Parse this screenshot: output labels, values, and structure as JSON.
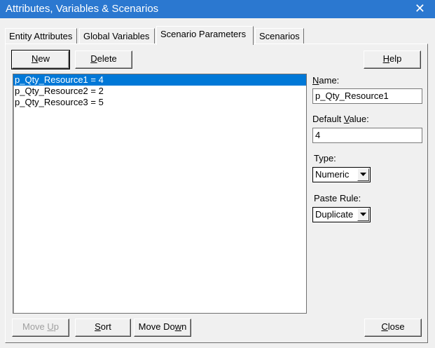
{
  "window": {
    "title": "Attributes, Variables & Scenarios"
  },
  "tabs": [
    {
      "label": "Entity Attributes"
    },
    {
      "label": "Global Variables"
    },
    {
      "label": "Scenario Parameters",
      "active": true
    },
    {
      "label": "Scenarios"
    }
  ],
  "toolbar": {
    "new_label": {
      "pre": "",
      "key": "N",
      "post": "ew"
    },
    "delete_label": {
      "pre": "",
      "key": "D",
      "post": "elete"
    },
    "help_label": {
      "pre": "",
      "key": "H",
      "post": "elp"
    }
  },
  "parameters": {
    "items": [
      "p_Qty_Resource1 = 4",
      "p_Qty_Resource2 = 2",
      "p_Qty_Resource3 = 5"
    ],
    "selected_index": 0
  },
  "details": {
    "name_label": {
      "pre": "",
      "key": "N",
      "post": "ame:"
    },
    "name_value": "p_Qty_Resource1",
    "default_label": {
      "pre": "Default ",
      "key": "V",
      "post": "alue:"
    },
    "default_value": "4",
    "type_label": "Type:",
    "type_value": "Numeric",
    "paste_label": "Paste Rule:",
    "paste_value": "Duplicate"
  },
  "footer": {
    "move_up_label": {
      "pre": "Move ",
      "key": "U",
      "post": "p"
    },
    "sort_label": {
      "pre": "",
      "key": "S",
      "post": "ort"
    },
    "move_down_label": {
      "pre": "Move Do",
      "key": "w",
      "post": "n"
    },
    "close_label": {
      "pre": "",
      "key": "C",
      "post": "lose"
    }
  },
  "colors": {
    "titlebar": "#2b78d0",
    "selection": "#0078d7",
    "disabled_text": "#a0a0a0"
  }
}
